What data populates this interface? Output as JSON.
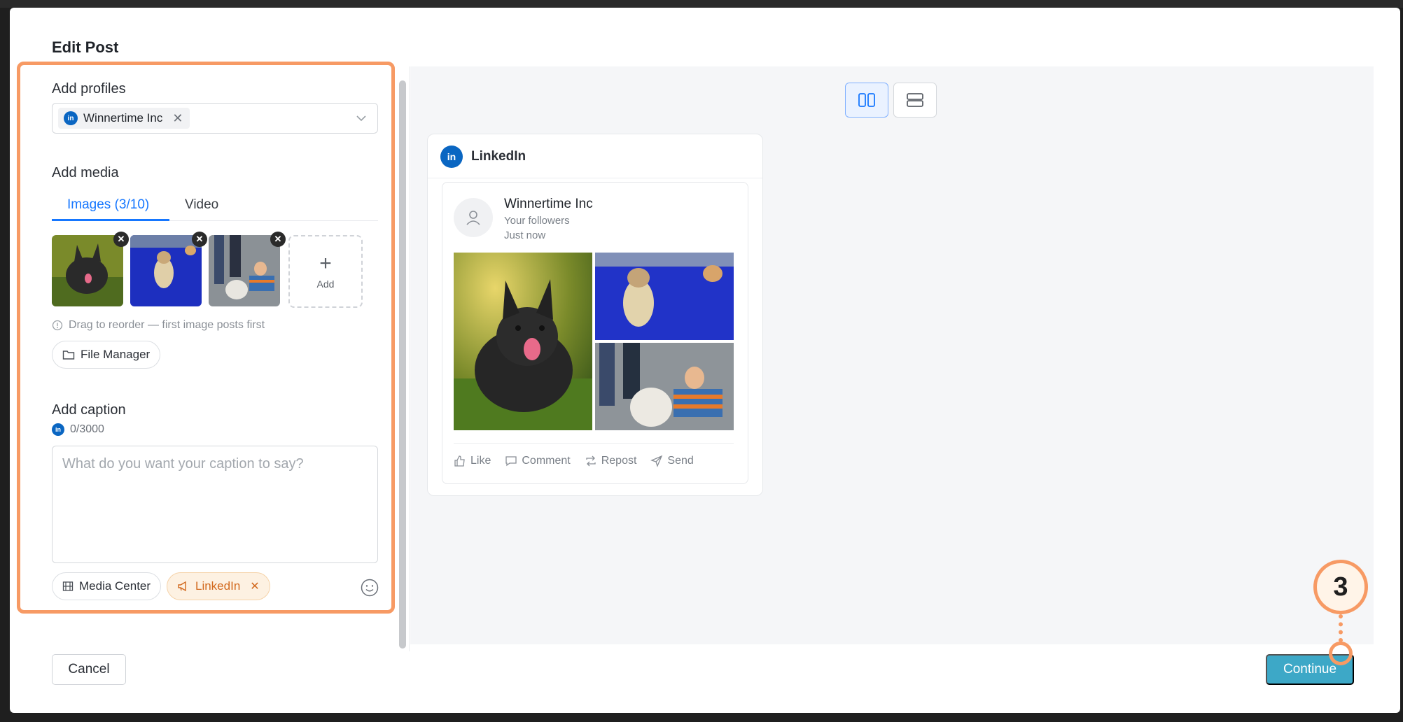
{
  "modal": {
    "title": "Edit Post"
  },
  "profiles": {
    "label": "Add profiles",
    "selected": [
      {
        "name": "Winnertime Inc",
        "network": "LinkedIn",
        "icon": "linkedin-icon"
      }
    ]
  },
  "media": {
    "label": "Add media",
    "tabs": [
      {
        "label": "Images (3/10)",
        "active": true
      },
      {
        "label": "Video",
        "active": false
      }
    ],
    "images": [
      {
        "alt": "dog-sitting-grass"
      },
      {
        "alt": "dog-running-blue"
      },
      {
        "alt": "dog-with-owners"
      }
    ],
    "add_label": "Add",
    "hint": "Drag to reorder — first image posts first",
    "file_manager_label": "File Manager"
  },
  "caption": {
    "label": "Add caption",
    "char_count": "0/3000",
    "placeholder": "What do you want your caption to say?",
    "media_center_label": "Media Center",
    "tag_label": "LinkedIn"
  },
  "preview": {
    "network": "LinkedIn",
    "post": {
      "author": "Winnertime Inc",
      "audience": "Your followers",
      "time": "Just now",
      "actions": [
        "Like",
        "Comment",
        "Repost",
        "Send"
      ]
    }
  },
  "footer": {
    "cancel_label": "Cancel",
    "continue_label": "Continue"
  },
  "step_marker": "3",
  "colors": {
    "accent": "#1677ff",
    "linkedin": "#0a66c2",
    "highlight": "#f79a64",
    "continue": "#3da8c7"
  }
}
